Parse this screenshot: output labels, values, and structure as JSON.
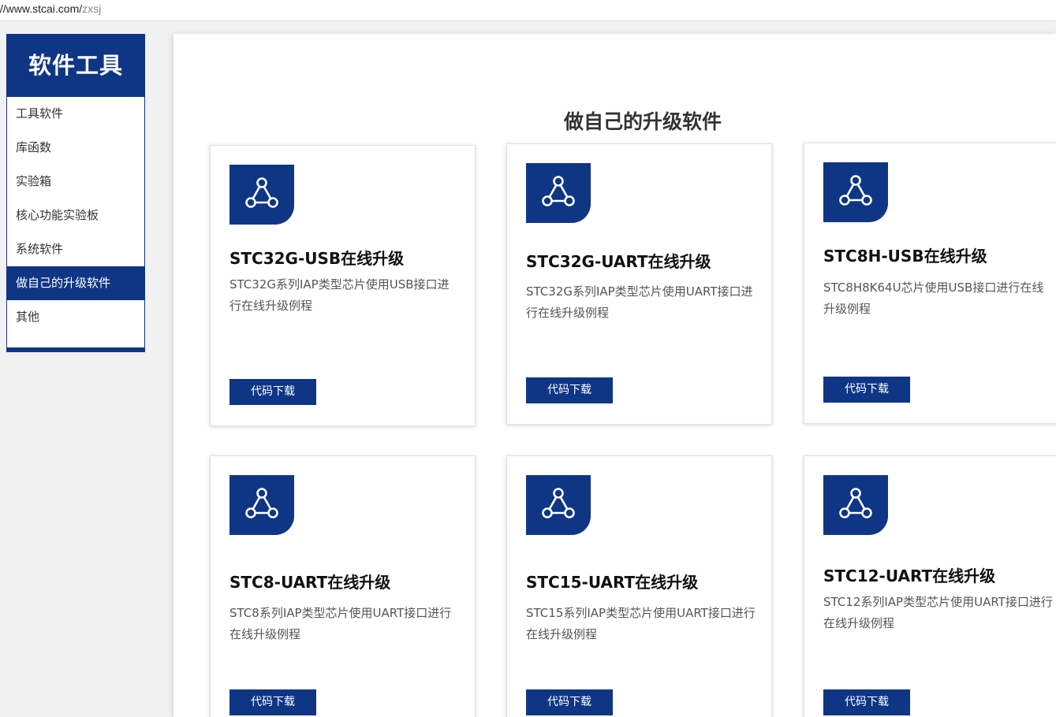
{
  "browser": {
    "url_host": "://www.stcai.com/",
    "url_path": "zxsj"
  },
  "sidebar": {
    "title": "软件工具",
    "items": [
      {
        "label": "工具软件",
        "active": false
      },
      {
        "label": "库函数",
        "active": false
      },
      {
        "label": "实验箱",
        "active": false
      },
      {
        "label": "核心功能实验板",
        "active": false
      },
      {
        "label": "系统软件",
        "active": false
      },
      {
        "label": "做自己的升级软件",
        "active": true
      },
      {
        "label": "其他",
        "active": false
      }
    ]
  },
  "main": {
    "title": "做自己的升级软件",
    "cards": [
      {
        "title": "STC32G-USB在线升级",
        "desc": "STC32G系列IAP类型芯片使用USB接口进行在线升级例程",
        "button": "代码下载",
        "icon": "share-network-icon"
      },
      {
        "title": "STC32G-UART在线升级",
        "desc": "STC32G系列IAP类型芯片使用UART接口进行在线升级例程",
        "button": "代码下载",
        "icon": "share-network-icon"
      },
      {
        "title": "STC8H-USB在线升级",
        "desc": "STC8H8K64U芯片使用USB接口进行在线升级例程",
        "button": "代码下载",
        "icon": "share-network-icon"
      },
      {
        "title": "STC8-UART在线升级",
        "desc": "STC8系列IAP类型芯片使用UART接口进行在线升级例程",
        "button": "代码下载",
        "icon": "share-network-icon"
      },
      {
        "title": "STC15-UART在线升级",
        "desc": "STC15系列IAP类型芯片使用UART接口进行在线升级例程",
        "button": "代码下载",
        "icon": "share-network-icon"
      },
      {
        "title": "STC12-UART在线升级",
        "desc": "STC12系列IAP类型芯片使用UART接口进行在线升级例程",
        "button": "代码下载",
        "icon": "share-network-icon"
      }
    ]
  },
  "colors": {
    "brand": "#0f3685",
    "background": "#f1f1f1"
  }
}
